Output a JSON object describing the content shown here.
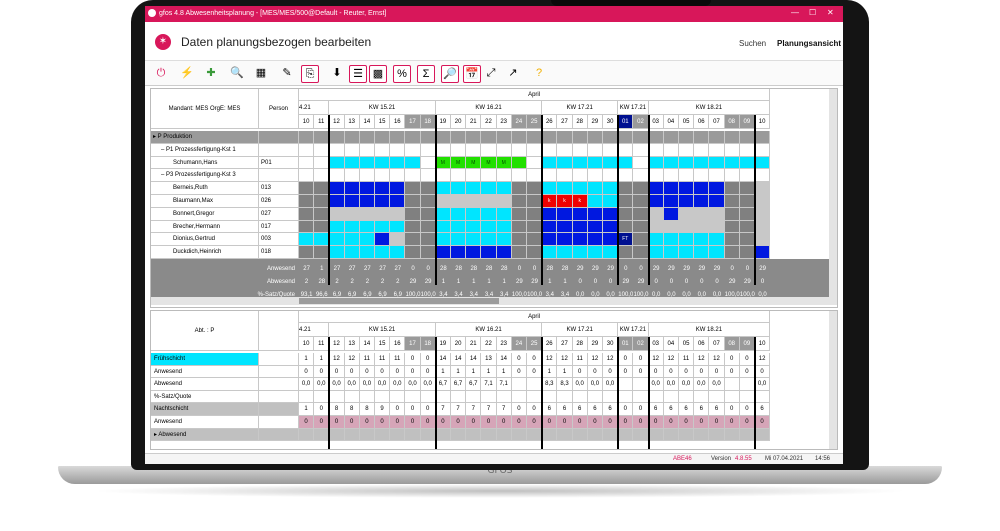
{
  "device": {
    "brand": "GFOS"
  },
  "window": {
    "title": "gfos 4.8  Abwesenheitsplanung - [MES/MES/500@Default - Reuter, Ernst]",
    "controls": [
      "—",
      "☐",
      "✕"
    ]
  },
  "header": {
    "page_title": "Daten planungsbezogen bearbeiten",
    "nav_search": "Suchen",
    "nav_plan": "Planungsansicht"
  },
  "toolbar": {
    "icons": [
      "power-icon",
      "lightning-icon",
      "add-icon",
      "search-doc-icon",
      "calendar-dropdown-icon",
      "edit-doc-icon",
      "copy-icon",
      "download-icon",
      "grid-view-icon",
      "color-grid-icon",
      "percent-icon",
      "sigma-icon",
      "doc-search-icon",
      "calendar-icon",
      "expand-icon",
      "help-arrow-icon",
      "question-icon"
    ],
    "glyphs": [
      "⏻",
      "⚡",
      "✚",
      "🔍",
      "▦",
      "✎",
      "⎘",
      "⬇",
      "☰",
      "▩",
      "%",
      "Σ",
      "🔎",
      "📅",
      "⤢",
      "↗",
      "?"
    ]
  },
  "upper": {
    "month": "April",
    "mandant": "Mandant: MES   OrgE: MES",
    "person_col": "Person",
    "weeks": [
      "4.21",
      "KW 15.21",
      "KW 16.21",
      "KW 17.21",
      "KW 17.21",
      "KW 18.21"
    ],
    "days": [
      "10",
      "11",
      "12",
      "13",
      "14",
      "15",
      "16",
      "17",
      "18",
      "19",
      "20",
      "21",
      "22",
      "23",
      "24",
      "25",
      "26",
      "27",
      "28",
      "29",
      "30",
      "01",
      "02",
      "03",
      "04",
      "05",
      "06",
      "07",
      "08",
      "09",
      "10"
    ],
    "rows": [
      {
        "label": "▸  P  Produktion",
        "id": "",
        "kind": "group"
      },
      {
        "label": "–  P1  Prozessfertigung-Kst 1",
        "id": "",
        "kind": "sub"
      },
      {
        "label": "Schumann,Hans",
        "id": "P01",
        "kind": "person"
      },
      {
        "label": "–  P3  Prozessfertigung-Kst 3",
        "id": "",
        "kind": "sub"
      },
      {
        "label": "Berneis,Ruth",
        "id": "013",
        "kind": "person"
      },
      {
        "label": "Blaumann,Max",
        "id": "026",
        "kind": "person"
      },
      {
        "label": "Bonnert,Gregor",
        "id": "027",
        "kind": "person"
      },
      {
        "label": "Brecher,Hermann",
        "id": "017",
        "kind": "person"
      },
      {
        "label": "Dionius,Gertrud",
        "id": "003",
        "kind": "person"
      },
      {
        "label": "Duckdich,Heinrich",
        "id": "018",
        "kind": "person"
      }
    ],
    "stats": [
      {
        "label": "Anwesend",
        "values": [
          "27",
          "1",
          "27",
          "27",
          "27",
          "27",
          "27",
          "0",
          "0",
          "28",
          "28",
          "28",
          "28",
          "28",
          "0",
          "0",
          "28",
          "28",
          "29",
          "29",
          "29",
          "0",
          "0",
          "29",
          "29",
          "29",
          "29",
          "29",
          "0",
          "0",
          "29"
        ]
      },
      {
        "label": "Abwesend",
        "values": [
          "2",
          "28",
          "2",
          "2",
          "2",
          "2",
          "2",
          "29",
          "29",
          "1",
          "1",
          "1",
          "1",
          "1",
          "29",
          "29",
          "1",
          "1",
          "0",
          "0",
          "0",
          "29",
          "29",
          "0",
          "0",
          "0",
          "0",
          "0",
          "29",
          "29",
          "0"
        ]
      },
      {
        "label": "%-Satz/Quote",
        "values": [
          "93,1",
          "96,6",
          "6,9",
          "6,9",
          "6,9",
          "6,9",
          "6,9",
          "100,0",
          "100,0",
          "3,4",
          "3,4",
          "3,4",
          "3,4",
          "3,4",
          "100,0",
          "100,0",
          "3,4",
          "3,4",
          "0,0",
          "0,0",
          "0,0",
          "100,0",
          "100,0",
          "0,0",
          "0,0",
          "0,0",
          "0,0",
          "0,0",
          "100,0",
          "100,0",
          "0,0"
        ]
      }
    ]
  },
  "lower": {
    "month": "April",
    "abt": "Abt. : P",
    "weeks": [
      "4.21",
      "KW 15.21",
      "KW 16.21",
      "KW 17.21",
      "KW 17.21",
      "KW 18.21"
    ],
    "days": [
      "10",
      "11",
      "12",
      "13",
      "14",
      "15",
      "16",
      "17",
      "18",
      "19",
      "20",
      "21",
      "22",
      "23",
      "24",
      "25",
      "26",
      "27",
      "28",
      "29",
      "30",
      "01",
      "02",
      "03",
      "04",
      "05",
      "06",
      "07",
      "08",
      "09",
      "10"
    ],
    "rows": [
      {
        "label": "Frühschicht",
        "kind": "cyan",
        "values": [
          "1",
          "1",
          "12",
          "12",
          "11",
          "11",
          "11",
          "0",
          "0",
          "14",
          "14",
          "14",
          "13",
          "14",
          "0",
          "0",
          "12",
          "12",
          "11",
          "12",
          "12",
          "0",
          "0",
          "12",
          "12",
          "11",
          "12",
          "12",
          "0",
          "0",
          "12"
        ]
      },
      {
        "label": "Anwesend",
        "kind": "plain",
        "values": [
          "0",
          "0",
          "0",
          "0",
          "0",
          "0",
          "0",
          "0",
          "0",
          "1",
          "1",
          "1",
          "1",
          "1",
          "0",
          "0",
          "1",
          "1",
          "0",
          "0",
          "0",
          "0",
          "0",
          "0",
          "0",
          "0",
          "0",
          "0",
          "0",
          "0",
          "0"
        ]
      },
      {
        "label": "Abwesend",
        "kind": "plain",
        "values": [
          "0,0",
          "0,0",
          "0,0",
          "0,0",
          "0,0",
          "0,0",
          "0,0",
          "0,0",
          "0,0",
          "6,7",
          "6,7",
          "6,7",
          "7,1",
          "7,1",
          "",
          "",
          "8,3",
          "8,3",
          "0,0",
          "0,0",
          "0,0",
          "",
          "",
          "0,0",
          "0,0",
          "0,0",
          "0,0",
          "0,0",
          "",
          "",
          "0,0"
        ]
      },
      {
        "label": "%-Satz/Quote",
        "kind": "plain",
        "values": [
          "",
          "",
          "",
          "",
          "",
          "",
          "",
          "",
          "",
          "",
          "",
          "",
          "",
          "",
          "",
          "",
          "",
          "",
          "",
          "",
          "",
          "",
          "",
          "",
          "",
          "",
          "",
          "",
          "",
          "",
          ""
        ]
      },
      {
        "label": "Nachtschicht",
        "kind": "grey",
        "values": [
          "1",
          "0",
          "8",
          "8",
          "8",
          "9",
          "0",
          "0",
          "0",
          "7",
          "7",
          "7",
          "7",
          "7",
          "0",
          "0",
          "6",
          "6",
          "6",
          "6",
          "6",
          "0",
          "0",
          "6",
          "6",
          "6",
          "6",
          "6",
          "0",
          "0",
          "6"
        ]
      },
      {
        "label": "Anwesend",
        "kind": "pink",
        "values": [
          "0",
          "0",
          "0",
          "0",
          "0",
          "0",
          "0",
          "0",
          "0",
          "0",
          "0",
          "0",
          "0",
          "0",
          "0",
          "0",
          "0",
          "0",
          "0",
          "0",
          "0",
          "0",
          "0",
          "0",
          "0",
          "0",
          "0",
          "0",
          "0",
          "0",
          "0"
        ]
      },
      {
        "label": "▸ Abwesend",
        "kind": "grey",
        "values": []
      }
    ]
  },
  "marks": {
    "m": "M",
    "k": "k",
    "ft": "FT"
  },
  "colors": {
    "accent": "#d8175a",
    "cyan": "#00e5ff",
    "blue": "#0018e0",
    "green": "#22e000",
    "red": "#f00000",
    "weekend": "#808080",
    "light": "#c8c8c8",
    "navy": "#001090",
    "pink": "#d6a5b8"
  },
  "statusbar": {
    "abe": "ABE46",
    "version_label": "Version",
    "version": "4.8.55",
    "date": "Mi 07.04.2021",
    "time": "14:56"
  }
}
